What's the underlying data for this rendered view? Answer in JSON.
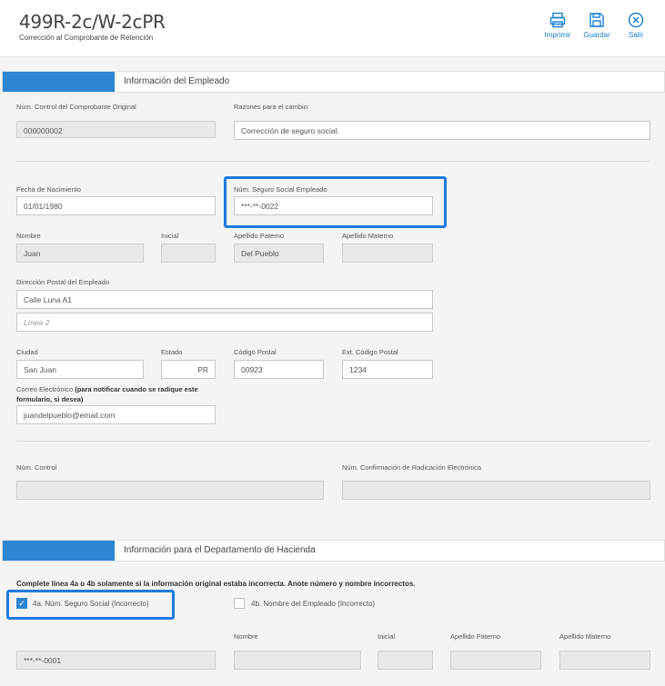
{
  "header": {
    "title": "499R-2c/W-2cPR",
    "subtitle": "Corrección al Comprobante de Retención",
    "actions": [
      {
        "label": "Imprimir",
        "icon": "printer-icon"
      },
      {
        "label": "Guardar",
        "icon": "save-icon"
      },
      {
        "label": "Salir",
        "icon": "close-circle-icon"
      }
    ]
  },
  "employee_section": {
    "heading": "Información del Empleado",
    "control_original": {
      "label": "Núm. Control del Comprobante Original",
      "value": "000000002"
    },
    "reasons": {
      "label": "Razones para el cambio:",
      "value": "Corrección de seguro social."
    },
    "birth_date": {
      "label": "Fecha de Nacimiento",
      "value": "01/01/1980"
    },
    "ssn": {
      "label": "Núm. Seguro Social Empleado",
      "value": "***-**-0022"
    },
    "first_name": {
      "label": "Nombre",
      "value": "Juan"
    },
    "initial": {
      "label": "Inicial",
      "value": ""
    },
    "last_name_paternal": {
      "label": "Apellido Paterno",
      "value": "Del Pueblo"
    },
    "last_name_maternal": {
      "label": "Apellido Materno",
      "value": ""
    },
    "address": {
      "label": "Dirección Postal del Empleado",
      "line1": "Calle Luna A1",
      "line2_placeholder": "Línea 2"
    },
    "city": {
      "label": "Ciudad",
      "value": "San Juan"
    },
    "state": {
      "label": "Estado",
      "value": "PR"
    },
    "zip": {
      "label": "Código Postal",
      "value": "00923"
    },
    "zip_ext": {
      "label": "Ext. Código Postal",
      "value": "1234"
    },
    "email": {
      "label_prefix": "Correo Electrónico ",
      "label_bold": "(para notificar cuando se radique este formulario, si desea)",
      "value": "juandelpueblo@email.com"
    },
    "control_num": {
      "label": "Núm. Control",
      "value": ""
    },
    "confirmation": {
      "label": "Núm. Confirmación de Radicación Electrónica",
      "value": ""
    }
  },
  "hacienda_section": {
    "heading": "Información para el Departamento de Hacienda",
    "note": "Complete línea 4a o 4b solamente si la información original estaba incorrecta. Anote número y nombre incorrectos.",
    "line_4a": {
      "label": "4a. Núm. Seguro Social (Incorrecto)",
      "checked": true,
      "value": "***-**-0001"
    },
    "line_4b": {
      "label": "4b. Nombre del Empleado (Incorrecto)",
      "checked": false
    },
    "name_label": "Nombre",
    "initial_label": "Inicial",
    "paternal_label": "Apellido Paterno",
    "maternal_label": "Apellido Materno"
  },
  "colors": {
    "accent": "#2e86d3",
    "highlight": "#1e7be0",
    "link": "#1a7fd1"
  }
}
